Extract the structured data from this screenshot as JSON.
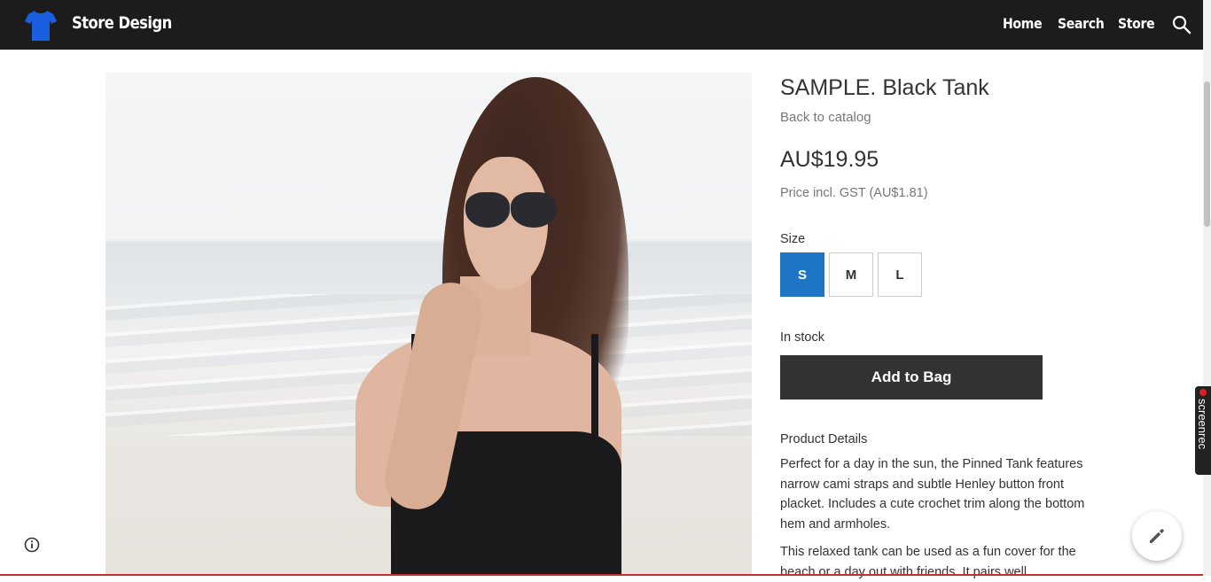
{
  "brand": {
    "name": "Store Design",
    "logo_icon": "tshirt-icon",
    "logo_color": "#1a5fe0"
  },
  "nav": {
    "items": [
      {
        "label": "Home"
      },
      {
        "label": "Search"
      },
      {
        "label": "Store"
      }
    ],
    "search_icon": "search-icon"
  },
  "product": {
    "title": "SAMPLE. Black Tank",
    "back_link": "Back to catalog",
    "price": "AU$19.95",
    "price_note": "Price incl. GST (AU$1.81)",
    "size_label": "Size",
    "sizes": [
      {
        "label": "S",
        "selected": true
      },
      {
        "label": "M",
        "selected": false
      },
      {
        "label": "L",
        "selected": false
      }
    ],
    "stock_status": "In stock",
    "add_to_bag_label": "Add to Bag",
    "details_heading": "Product Details",
    "details_paragraph_1": "Perfect for a day in the sun, the Pinned Tank features narrow cami straps and subtle Henley button front placket. Includes a cute crochet trim along the bottom hem and armholes.",
    "details_paragraph_2": "This relaxed tank can be used as a fun cover for the beach or a day out with friends. It pairs well"
  },
  "colors": {
    "topbar_bg": "#1c1c1c",
    "selected_size": "#1e74c5",
    "add_to_bag_bg": "#333333"
  },
  "overlays": {
    "info_icon": "info-icon",
    "edit_icon": "pencil-icon",
    "screenrec_label": "screenrec"
  }
}
